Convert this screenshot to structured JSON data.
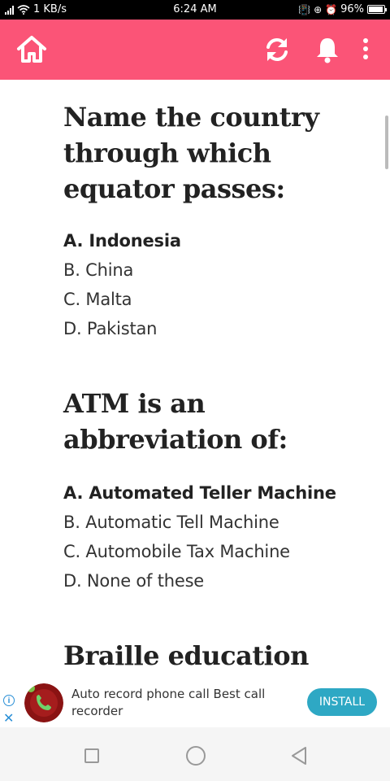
{
  "status_bar": {
    "speed": "1 KB/s",
    "time": "6:24 AM",
    "battery": "96%",
    "battery_level": 0.96,
    "icons": [
      "signal-icon",
      "wifi-icon",
      "vibrate-icon",
      "data-saver-icon",
      "alarm-icon",
      "battery-icon"
    ]
  },
  "appbar": {
    "color": "#fb5477",
    "icons": [
      "home-icon",
      "refresh-icon",
      "bell-icon",
      "more-vert-icon"
    ]
  },
  "questions": [
    {
      "text": "Name the country through which equator passes:",
      "options": [
        "A. Indonesia",
        "B. China",
        "C. Malta",
        "D. Pakistan"
      ],
      "correct_index": 0
    },
    {
      "text": "ATM is an abbreviation of:",
      "options": [
        "A. Automated Teller Machine",
        "B. Automatic Tell Machine",
        "C. Automobile Tax Machine",
        "D. None of these"
      ],
      "correct_index": 0
    },
    {
      "text": "Braille education"
    }
  ],
  "ad": {
    "text": "Auto record phone call Best call recorder",
    "install_label": "INSTALL",
    "info_icon": "info-icon",
    "close_icon": "close-icon",
    "accent": "#2ea8c4"
  },
  "navbar": {
    "icons": [
      "recents-icon",
      "home-circle-icon",
      "back-icon"
    ]
  }
}
